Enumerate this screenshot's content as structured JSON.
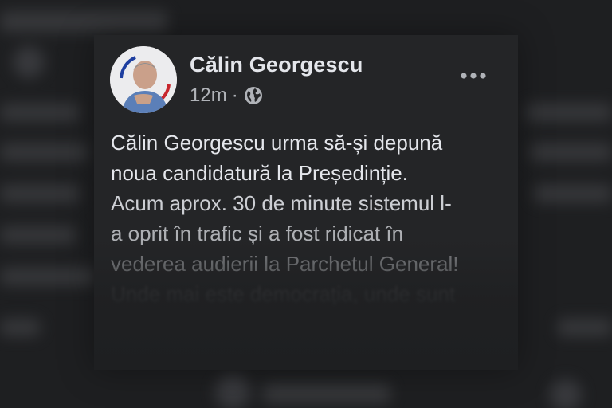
{
  "post": {
    "author": "Călin Georgescu",
    "time": "12m",
    "separator": "·",
    "audience_icon": "globe-icon",
    "more_icon": "more-options-icon",
    "text_lines": [
      "Călin Georgescu urma să-și depună",
      "noua candidatură la Președinție.",
      "Acum aprox. 30 de minute sistemul l-",
      "a oprit în trafic și a fost ridicat în",
      "vederea audierii la Parchetul General!",
      "Unde mai este democrația, unde sunt"
    ]
  },
  "colors": {
    "background": "#1e1f21",
    "card": "#242527",
    "primary_text": "#e4e6eb",
    "secondary_text": "#b0b3b8"
  }
}
